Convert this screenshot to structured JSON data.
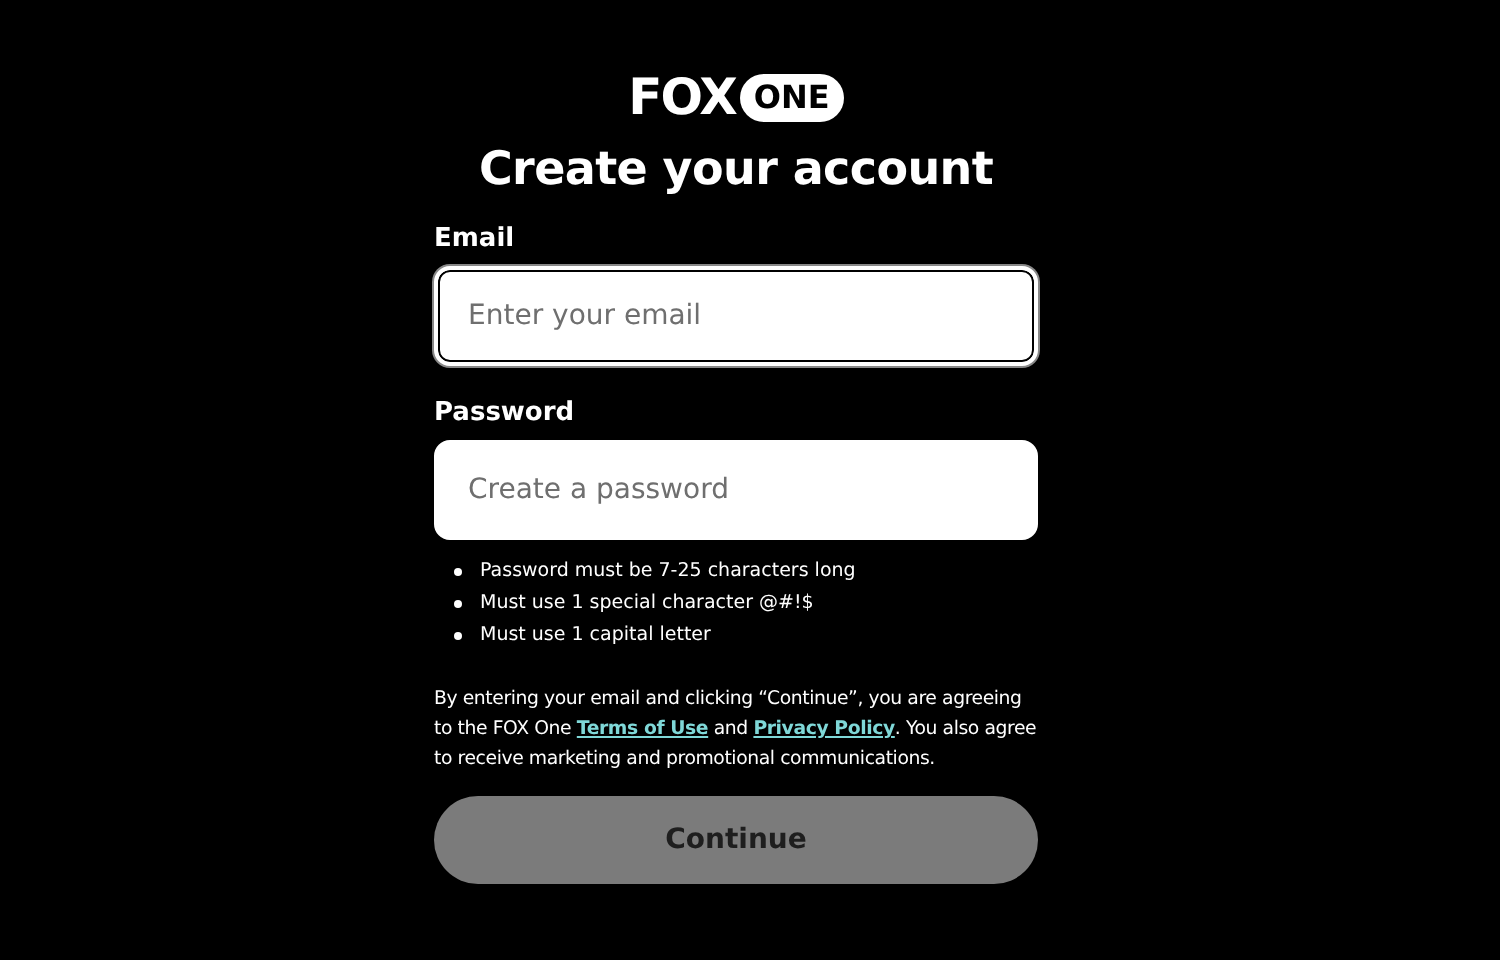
{
  "logo": {
    "primary": "FOX",
    "secondary": "ONE"
  },
  "title": "Create your account",
  "fields": [
    {
      "label": "Email",
      "placeholder": "Enter your email",
      "focused": true
    },
    {
      "label": "Password",
      "placeholder": "Create a password",
      "focused": false
    }
  ],
  "password_rules": [
    "Password must be 7-25 characters long",
    "Must use 1 special character @#!$",
    "Must use 1 capital letter"
  ],
  "legal": {
    "before": "By entering your email and clicking “Continue”, you are agreeing to the FOX One ",
    "terms_link": "Terms of Use",
    "middle": " and ",
    "privacy_link": "Privacy Policy",
    "after": ". You also agree to receive marketing and promotional communications."
  },
  "continue_button": {
    "label": "Continue",
    "disabled": true
  }
}
